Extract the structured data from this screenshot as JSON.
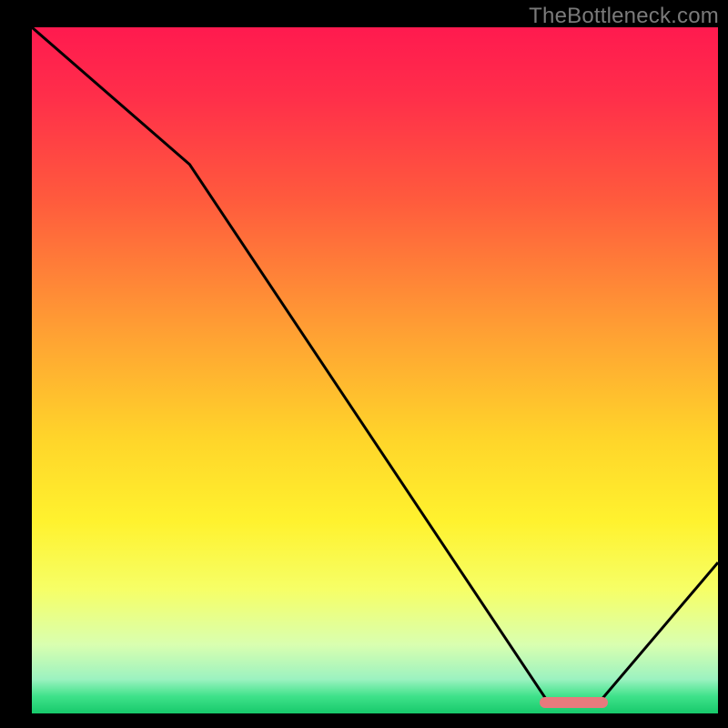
{
  "attribution": "TheBottleneck.com",
  "chart_data": {
    "type": "line",
    "title": "",
    "xlabel": "",
    "ylabel": "",
    "xlim": [
      0,
      100
    ],
    "ylim": [
      0,
      100
    ],
    "x": [
      0,
      23,
      75,
      83,
      100
    ],
    "y": [
      100,
      80,
      2,
      2,
      22
    ],
    "optimal_range_x": [
      74,
      84
    ],
    "gradient_stops": [
      {
        "pos": 0.0,
        "color": "#ff1a4f"
      },
      {
        "pos": 0.1,
        "color": "#ff2e4a"
      },
      {
        "pos": 0.25,
        "color": "#ff5a3d"
      },
      {
        "pos": 0.45,
        "color": "#ffa233"
      },
      {
        "pos": 0.6,
        "color": "#ffd52a"
      },
      {
        "pos": 0.72,
        "color": "#fff22e"
      },
      {
        "pos": 0.82,
        "color": "#f6ff67"
      },
      {
        "pos": 0.9,
        "color": "#d9ffb0"
      },
      {
        "pos": 0.95,
        "color": "#9cf2c0"
      },
      {
        "pos": 0.975,
        "color": "#3fe28a"
      },
      {
        "pos": 1.0,
        "color": "#17c96b"
      }
    ]
  },
  "colors": {
    "line": "#000000",
    "marker": "#e77a7d",
    "attribution_text": "#7a7a7a"
  }
}
